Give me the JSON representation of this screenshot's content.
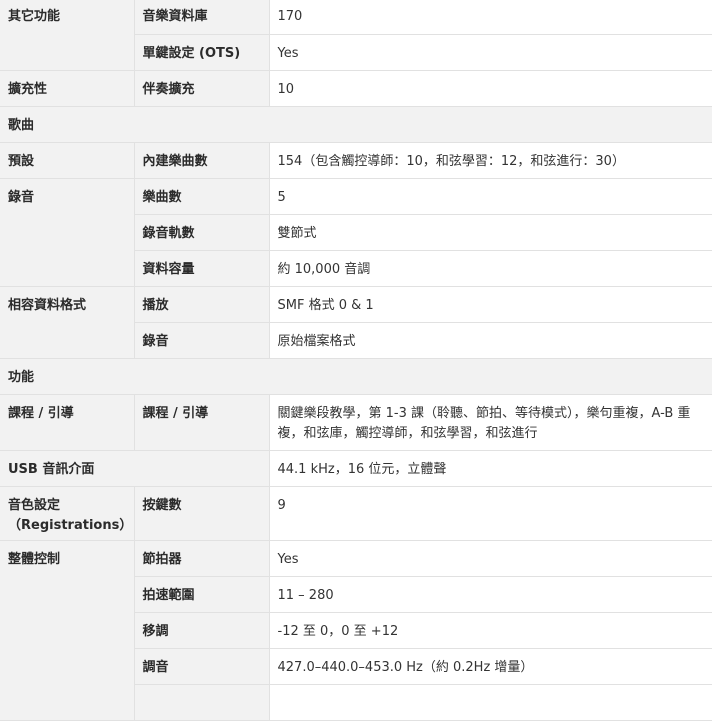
{
  "rows": {
    "r1": {
      "group": "其它功能",
      "label": "音樂資料庫",
      "value": "170"
    },
    "r2": {
      "label": "單鍵設定 (OTS)",
      "value": "Yes"
    },
    "r3": {
      "group": "擴充性",
      "label": "伴奏擴充",
      "value": "10"
    },
    "s1": {
      "title": "歌曲"
    },
    "r4": {
      "group": "預設",
      "label": "內建樂曲數",
      "value": "154（包含觸控導師：10，和弦學習：12，和弦進行：30）"
    },
    "r5": {
      "group": "錄音",
      "label": "樂曲數",
      "value": "5"
    },
    "r6": {
      "label": "錄音軌數",
      "value": "雙節式"
    },
    "r7": {
      "label": "資料容量",
      "value": "約 10,000 音調"
    },
    "r8": {
      "group": "相容資料格式",
      "label": "播放",
      "value": "SMF 格式 0 & 1"
    },
    "r9": {
      "label": "錄音",
      "value": "原始檔案格式"
    },
    "s2": {
      "title": "功能"
    },
    "r10": {
      "group": "課程 / 引導",
      "label": "課程 / 引導",
      "value": "關鍵樂段教學，第 1-3 課（聆聽、節拍、等待模式），樂句重複，A-B 重複，和弦庫，觸控導師，和弦學習，和弦進行"
    },
    "r11": {
      "label": "USB 音訊介面",
      "value": "44.1 kHz，16 位元，立體聲"
    },
    "r12": {
      "group": "音色設定（Registrations）",
      "label": "按鍵數",
      "value": "9"
    },
    "r13": {
      "group": "整體控制",
      "label": "節拍器",
      "value": "Yes"
    },
    "r14": {
      "label": "拍速範圍",
      "value": "11 – 280"
    },
    "r15": {
      "label": "移調",
      "value": "-12 至 0，0 至 +12"
    },
    "r16": {
      "label": "調音",
      "value": "427.0–440.0–453.0 Hz（約 0.2Hz 增量）"
    }
  }
}
